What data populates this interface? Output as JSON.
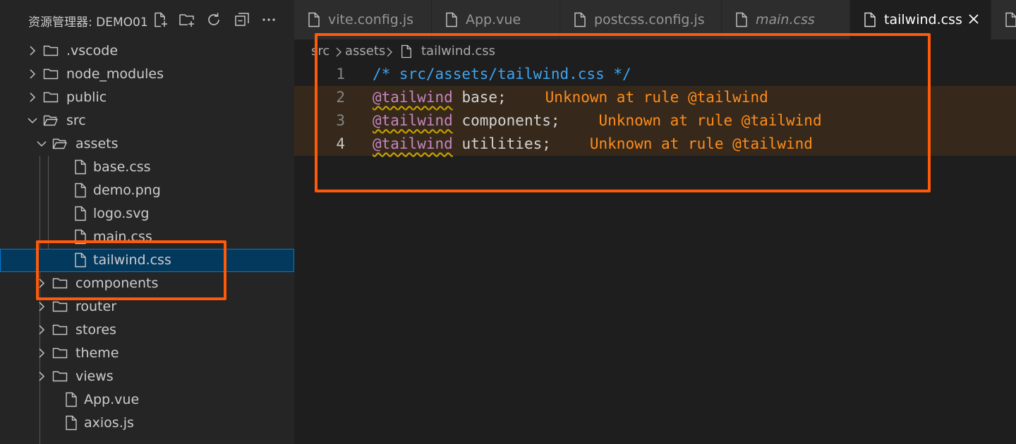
{
  "explorer": {
    "title": "资源管理器: DEMO01",
    "actions": [
      {
        "name": "new-file-icon"
      },
      {
        "name": "new-folder-icon"
      },
      {
        "name": "refresh-icon"
      },
      {
        "name": "collapse-all-icon"
      },
      {
        "name": "more-icon"
      }
    ],
    "items": [
      {
        "label": ".vscode",
        "type": "folder",
        "expanded": false,
        "depth": 0
      },
      {
        "label": "node_modules",
        "type": "folder",
        "expanded": false,
        "depth": 0
      },
      {
        "label": "public",
        "type": "folder",
        "expanded": false,
        "depth": 0
      },
      {
        "label": "src",
        "type": "folder",
        "expanded": true,
        "depth": 0
      },
      {
        "label": "assets",
        "type": "folder",
        "expanded": true,
        "depth": 1
      },
      {
        "label": "base.css",
        "type": "file",
        "depth": 2
      },
      {
        "label": "demo.png",
        "type": "file",
        "depth": 2
      },
      {
        "label": "logo.svg",
        "type": "file",
        "depth": 2
      },
      {
        "label": "main.css",
        "type": "file",
        "depth": 2
      },
      {
        "label": "tailwind.css",
        "type": "file",
        "depth": 2,
        "selected": true
      },
      {
        "label": "components",
        "type": "folder",
        "expanded": false,
        "depth": 1
      },
      {
        "label": "router",
        "type": "folder",
        "expanded": false,
        "depth": 1
      },
      {
        "label": "stores",
        "type": "folder",
        "expanded": false,
        "depth": 1
      },
      {
        "label": "theme",
        "type": "folder",
        "expanded": false,
        "depth": 1
      },
      {
        "label": "views",
        "type": "folder",
        "expanded": false,
        "depth": 1
      },
      {
        "label": "App.vue",
        "type": "file",
        "depth": 1
      },
      {
        "label": "axios.js",
        "type": "file",
        "depth": 1
      }
    ]
  },
  "tabs": [
    {
      "label": "vite.config.js",
      "active": false,
      "italic": false
    },
    {
      "label": "App.vue",
      "active": false,
      "italic": false
    },
    {
      "label": "postcss.config.js",
      "active": false,
      "italic": false
    },
    {
      "label": "main.css",
      "active": false,
      "italic": true
    },
    {
      "label": "tailwind.css",
      "active": true,
      "italic": false
    }
  ],
  "breadcrumb": [
    "src",
    "assets",
    "tailwind.css"
  ],
  "editor": {
    "lines": [
      {
        "number": "1",
        "tokens": [
          {
            "t": "comment",
            "v": "/* src/assets/tailwind.css */"
          }
        ]
      },
      {
        "number": "2",
        "tokens": [
          {
            "t": "at",
            "v": "@tailwind"
          },
          {
            "t": "plain",
            "v": " base;"
          }
        ],
        "warning": "Unknown at rule @tailwind"
      },
      {
        "number": "3",
        "tokens": [
          {
            "t": "at",
            "v": "@tailwind"
          },
          {
            "t": "plain",
            "v": " components;"
          }
        ],
        "warning": "Unknown at rule @tailwind"
      },
      {
        "number": "4",
        "tokens": [
          {
            "t": "at",
            "v": "@tailwind"
          },
          {
            "t": "plain",
            "v": " utilities;"
          }
        ],
        "warning": "Unknown at rule @tailwind",
        "current": true
      }
    ]
  },
  "colors": {
    "accent": "#0078d4",
    "annotation": "#ff5a0a",
    "warning_text": "#ff8c1a",
    "keyword": "#c586c0",
    "comment": "#3fa4f0"
  }
}
